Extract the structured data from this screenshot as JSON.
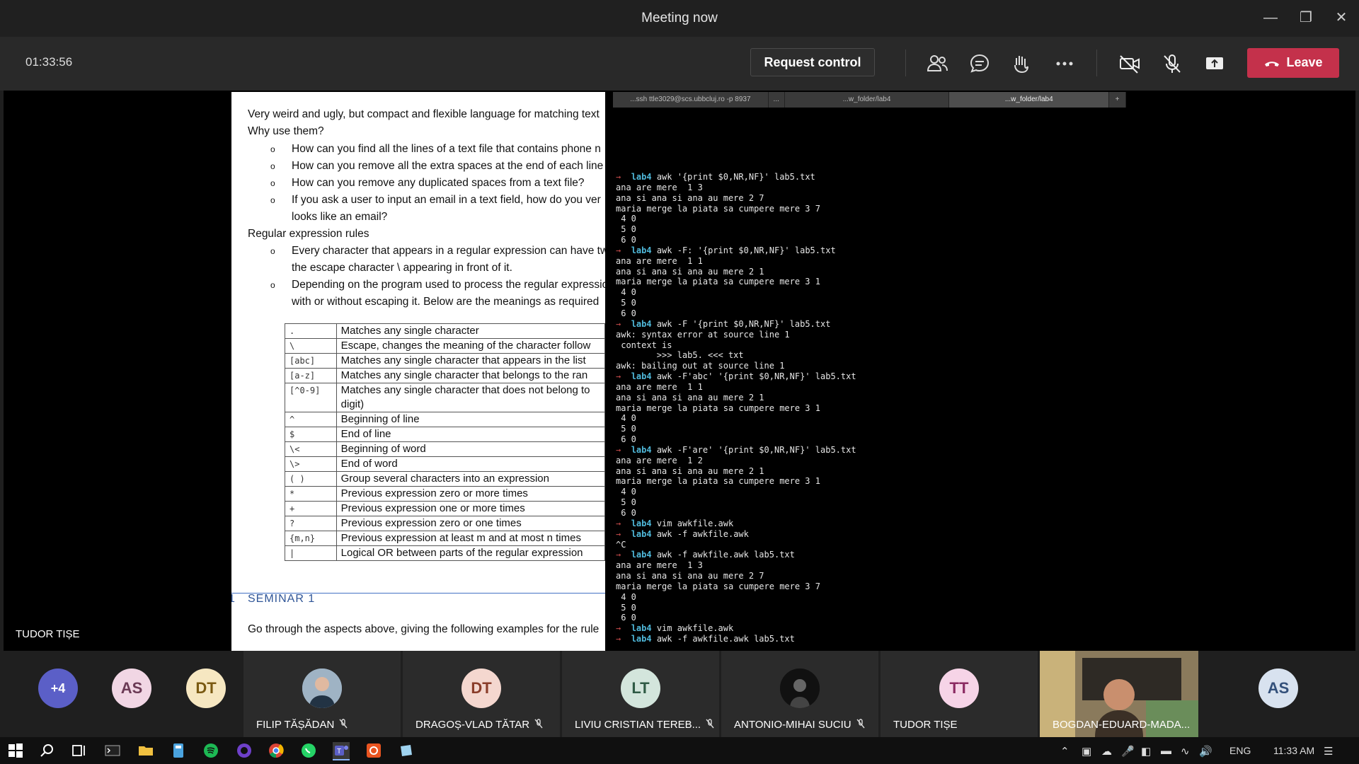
{
  "window": {
    "title": "Meeting now"
  },
  "toolbar": {
    "timer": "01:33:56",
    "request_control": "Request control",
    "leave": "Leave"
  },
  "document": {
    "intro": "Very weird and ugly, but compact and flexible language for matching text",
    "why": "Why use them?",
    "bullets": [
      "How can you find all the lines of a text file that contains phone n",
      "How can you remove all the extra spaces at the end of each line",
      "How can you remove any duplicated spaces from a text file?",
      "If you ask a user to input an email in a text field, how do you ver",
      "looks like an email?"
    ],
    "rules_heading": "Regular expression rules",
    "rules": [
      "Every character that appears in a regular expression can have tw",
      "the escape character \\ appearing in front of it.",
      "Depending on the program used to process the regular expressio",
      "with or without escaping it. Below are the meanings as required"
    ],
    "table": [
      {
        "sym": ".",
        "desc": "Matches any single character"
      },
      {
        "sym": "\\",
        "desc": "Escape, changes the meaning of the character follow"
      },
      {
        "sym": "[abc]",
        "desc": "Matches any single character that appears in the list"
      },
      {
        "sym": "[a-z]",
        "desc": "Matches any single character that belongs to the ran"
      },
      {
        "sym": "[^0-9]",
        "desc": "Matches any single character that does not belong to"
      },
      {
        "sym": "",
        "desc": "digit)"
      },
      {
        "sym": "^",
        "desc": "Beginning of line"
      },
      {
        "sym": "$",
        "desc": "End of line"
      },
      {
        "sym": "\\<",
        "desc": "Beginning of word"
      },
      {
        "sym": "\\>",
        "desc": "End of word"
      },
      {
        "sym": "( )",
        "desc": "Group several characters into an expression"
      },
      {
        "sym": "*",
        "desc": "Previous expression zero or more times"
      },
      {
        "sym": "+",
        "desc": "Previous expression one or more times"
      },
      {
        "sym": "?",
        "desc": "Previous expression zero or one times"
      },
      {
        "sym": "{m,n}",
        "desc": "Previous expression at least m and at most n times"
      },
      {
        "sym": "|",
        "desc": "Logical OR between parts of the regular expression"
      }
    ],
    "seminar_num": "1",
    "seminar_title": "SEMINAR 1",
    "seminar_item": "Go through the aspects above, giving the following examples for the rule"
  },
  "terminal": {
    "tabs": [
      "...ssh ttle3029@scs.ubbcluj.ro -p 8937",
      "...",
      "...w_folder/lab4",
      "...w_folder/lab4",
      "+"
    ],
    "lines": [
      {
        "p": true,
        "dir": "lab4",
        "cmd": "awk '{print $0,NR,NF}' lab5.txt"
      },
      {
        "t": "ana are mere  1 3"
      },
      {
        "t": "ana si ana si ana au mere 2 7"
      },
      {
        "t": "maria merge la piata sa cumpere mere 3 7"
      },
      {
        "t": " 4 0"
      },
      {
        "t": " 5 0"
      },
      {
        "t": " 6 0"
      },
      {
        "p": true,
        "dir": "lab4",
        "cmd": "awk -F: '{print $0,NR,NF}' lab5.txt"
      },
      {
        "t": "ana are mere  1 1"
      },
      {
        "t": "ana si ana si ana au mere 2 1"
      },
      {
        "t": "maria merge la piata sa cumpere mere 3 1"
      },
      {
        "t": " 4 0"
      },
      {
        "t": " 5 0"
      },
      {
        "t": " 6 0"
      },
      {
        "p": true,
        "dir": "lab4",
        "cmd": "awk -F '{print $0,NR,NF}' lab5.txt"
      },
      {
        "t": "awk: syntax error at source line 1"
      },
      {
        "t": " context is"
      },
      {
        "t": "        >>> lab5. <<< txt"
      },
      {
        "t": "awk: bailing out at source line 1"
      },
      {
        "p": true,
        "dir": "lab4",
        "cmd": "awk -F'abc' '{print $0,NR,NF}' lab5.txt"
      },
      {
        "t": "ana are mere  1 1"
      },
      {
        "t": "ana si ana si ana au mere 2 1"
      },
      {
        "t": "maria merge la piata sa cumpere mere 3 1"
      },
      {
        "t": " 4 0"
      },
      {
        "t": " 5 0"
      },
      {
        "t": " 6 0"
      },
      {
        "p": true,
        "dir": "lab4",
        "cmd": "awk -F'are' '{print $0,NR,NF}' lab5.txt"
      },
      {
        "t": "ana are mere  1 2"
      },
      {
        "t": "ana si ana si ana au mere 2 1"
      },
      {
        "t": "maria merge la piata sa cumpere mere 3 1"
      },
      {
        "t": " 4 0"
      },
      {
        "t": " 5 0"
      },
      {
        "t": " 6 0"
      },
      {
        "p": true,
        "dir": "lab4",
        "cmd": "vim awkfile.awk"
      },
      {
        "p": true,
        "dir": "lab4",
        "cmd": "awk -f awkfile.awk"
      },
      {
        "t": "^C"
      },
      {
        "p": true,
        "dir": "lab4",
        "cmd": "awk -f awkfile.awk lab5.txt"
      },
      {
        "t": "ana are mere  1 3"
      },
      {
        "t": "ana si ana si ana au mere 2 7"
      },
      {
        "t": "maria merge la piata sa cumpere mere 3 7"
      },
      {
        "t": " 4 0"
      },
      {
        "t": " 5 0"
      },
      {
        "t": " 6 0"
      },
      {
        "p": true,
        "dir": "lab4",
        "cmd": "vim awkfile.awk"
      },
      {
        "p": true,
        "dir": "lab4",
        "cmd": "awk -f awkfile.awk lab5.txt"
      }
    ]
  },
  "presenter": "TUDOR TIȘE",
  "participants": [
    {
      "initials": "+4",
      "color": "#5b5fc7"
    },
    {
      "initials": "AS",
      "color": "#f1d6e4",
      "fg": "#6b3a55"
    },
    {
      "initials": "DT",
      "color": "#f6e7c1",
      "fg": "#7a5a12"
    },
    {
      "name": "FILIP TĂȘĂDAN",
      "photo": true
    },
    {
      "name": "DRAGOȘ-VLAD TĂTAR",
      "initials": "DT",
      "color": "#f4d7cf",
      "fg": "#8a3d2a"
    },
    {
      "name": "LIVIU CRISTIAN TEREB...",
      "initials": "LT",
      "color": "#d3e5dc",
      "fg": "#2f5a45"
    },
    {
      "name": "ANTONIO-MIHAI SUCIU",
      "photo": true
    },
    {
      "name": "TUDOR TIȘE",
      "initials": "TT",
      "color": "#f6d4e7",
      "fg": "#8b2a62"
    },
    {
      "name": "BOGDAN-EDUARD-MADA..."
    },
    {
      "initials": "AS",
      "color": "#d8e2ef",
      "fg": "#33507a"
    }
  ],
  "taskbar": {
    "lang": "ENG",
    "time": "11:33 AM"
  }
}
